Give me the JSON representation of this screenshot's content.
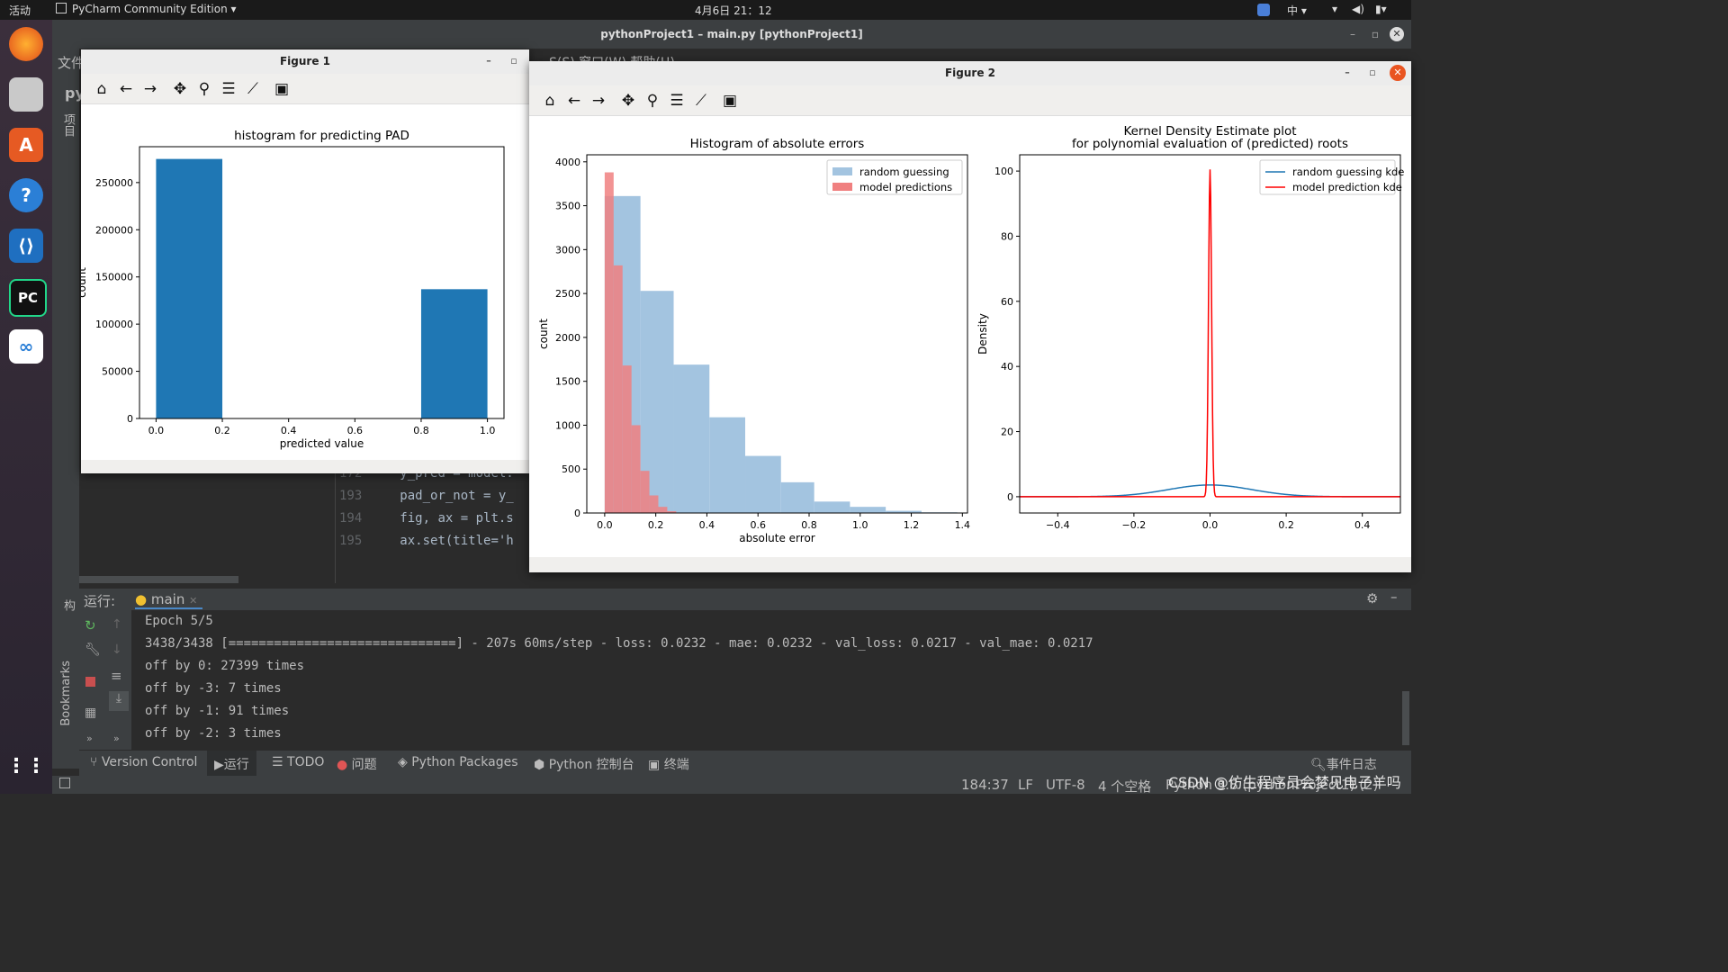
{
  "topbar": {
    "activities": "活动",
    "app": "PyCharm Community Edition ▾",
    "clock": "4月6日  21：12",
    "ime": "中 ▾"
  },
  "ide": {
    "title": "pythonProject1 – main.py [pythonProject1]",
    "menu_file": "文件",
    "menu_partial": "S(S)   窗口(W)   帮助(H)",
    "project_label": "项目",
    "py_label": "py",
    "structure_label": "结构",
    "bookmarks_label": "Bookmarks",
    "code_lines": [
      {
        "no": "172",
        "text": "y_pred = model."
      },
      {
        "no": "193",
        "text": "pad_or_not = y_"
      },
      {
        "no": "194",
        "text": "fig, ax = plt.s"
      },
      {
        "no": "195",
        "text": "ax.set(title='h"
      }
    ]
  },
  "run_panel": {
    "label": "运行:",
    "tab": "main",
    "lines": [
      "Epoch 5/5",
      "3438/3438 [==============================] - 207s 60ms/step - loss: 0.0232 - mae: 0.0232 - val_loss: 0.0217 - val_mae: 0.0217",
      "off by 0: 27399 times",
      "off by -3: 7 times",
      "off by -1: 91 times",
      "off by -2: 3 times"
    ]
  },
  "bottom_tabs": [
    "Version Control",
    "运行",
    "TODO",
    "问题",
    "Python Packages",
    "Python 控制台",
    "终端"
  ],
  "event_log": "事件日志",
  "status": {
    "position": "184:37",
    "line_sep": "LF",
    "encoding": "UTF-8",
    "indent": "4 个空格",
    "interpreter": "Python 3.8 (pythonProject1) (2)",
    "watermark": "CSDN @仿生程序员会梦见电子羊吗"
  },
  "figure1": {
    "title": "Figure 1"
  },
  "figure2": {
    "title": "Figure 2"
  },
  "colors": {
    "blue": "#1f77b4",
    "red": "#ff0000",
    "hist_blue": "#a3c4e0",
    "hist_red": "#f08080"
  },
  "chart_data": [
    {
      "type": "bar",
      "title": "histogram for predicting PAD",
      "xlabel": "predicted value",
      "ylabel": "count",
      "bins": [
        {
          "x0": 0.0,
          "x1": 0.2,
          "y": 275000
        },
        {
          "x0": 0.8,
          "x1": 1.0,
          "y": 137000
        }
      ],
      "xlim": [
        -0.05,
        1.05
      ],
      "ylim": [
        0,
        288000
      ],
      "xticks": [
        "0.0",
        "0.2",
        "0.4",
        "0.6",
        "0.8",
        "1.0"
      ],
      "yticks": [
        "0",
        "50000",
        "100000",
        "150000",
        "200000",
        "250000"
      ]
    },
    {
      "type": "bar",
      "title": "Histogram of absolute errors",
      "xlabel": "absolute error",
      "ylabel": "count",
      "xlim": [
        -0.07,
        1.42
      ],
      "ylim": [
        0,
        4080
      ],
      "xticks": [
        "0.0",
        "0.2",
        "0.4",
        "0.6",
        "0.8",
        "1.0",
        "1.2",
        "1.4"
      ],
      "yticks": [
        "0",
        "500",
        "1000",
        "1500",
        "2000",
        "2500",
        "3000",
        "3500",
        "4000"
      ],
      "legend": "top-right",
      "series": [
        {
          "name": "random guessing",
          "color": "#a3c4e0",
          "bins": [
            {
              "x0": 0.0,
              "x1": 0.14,
              "y": 3610
            },
            {
              "x0": 0.14,
              "x1": 0.27,
              "y": 2530
            },
            {
              "x0": 0.27,
              "x1": 0.41,
              "y": 1690
            },
            {
              "x0": 0.41,
              "x1": 0.55,
              "y": 1090
            },
            {
              "x0": 0.55,
              "x1": 0.69,
              "y": 650
            },
            {
              "x0": 0.69,
              "x1": 0.82,
              "y": 350
            },
            {
              "x0": 0.82,
              "x1": 0.96,
              "y": 130
            },
            {
              "x0": 0.96,
              "x1": 1.1,
              "y": 70
            },
            {
              "x0": 1.1,
              "x1": 1.24,
              "y": 25
            },
            {
              "x0": 1.24,
              "x1": 1.38,
              "y": 8
            }
          ]
        },
        {
          "name": "model predictions",
          "color": "#f08080",
          "bins": [
            {
              "x0": 0.0,
              "x1": 0.035,
              "y": 3880
            },
            {
              "x0": 0.035,
              "x1": 0.07,
              "y": 2820
            },
            {
              "x0": 0.07,
              "x1": 0.105,
              "y": 1680
            },
            {
              "x0": 0.105,
              "x1": 0.14,
              "y": 1000
            },
            {
              "x0": 0.14,
              "x1": 0.175,
              "y": 480
            },
            {
              "x0": 0.175,
              "x1": 0.21,
              "y": 200
            },
            {
              "x0": 0.21,
              "x1": 0.245,
              "y": 70
            },
            {
              "x0": 0.245,
              "x1": 0.28,
              "y": 20
            }
          ]
        }
      ]
    },
    {
      "type": "line",
      "title": "Kernel Density Estimate plot",
      "subtitle": "for polynomial evaluation of (predicted) roots",
      "xlabel": "",
      "ylabel": "Density",
      "xlim": [
        -0.5,
        0.5
      ],
      "ylim": [
        -5,
        105
      ],
      "xticks": [
        "−0.4",
        "−0.2",
        "0.0",
        "0.2",
        "0.4"
      ],
      "yticks": [
        "0",
        "20",
        "40",
        "60",
        "80",
        "100"
      ],
      "legend": "top-right",
      "series": [
        {
          "name": "random guessing kde",
          "color": "#1f77b4",
          "kind": "gauss",
          "mu": 0.0,
          "sigma": 0.11,
          "peak": 3.6
        },
        {
          "name": "model prediction kde",
          "color": "#ff0000",
          "kind": "gauss",
          "mu": 0.0,
          "sigma": 0.004,
          "peak": 100.5
        }
      ]
    }
  ]
}
